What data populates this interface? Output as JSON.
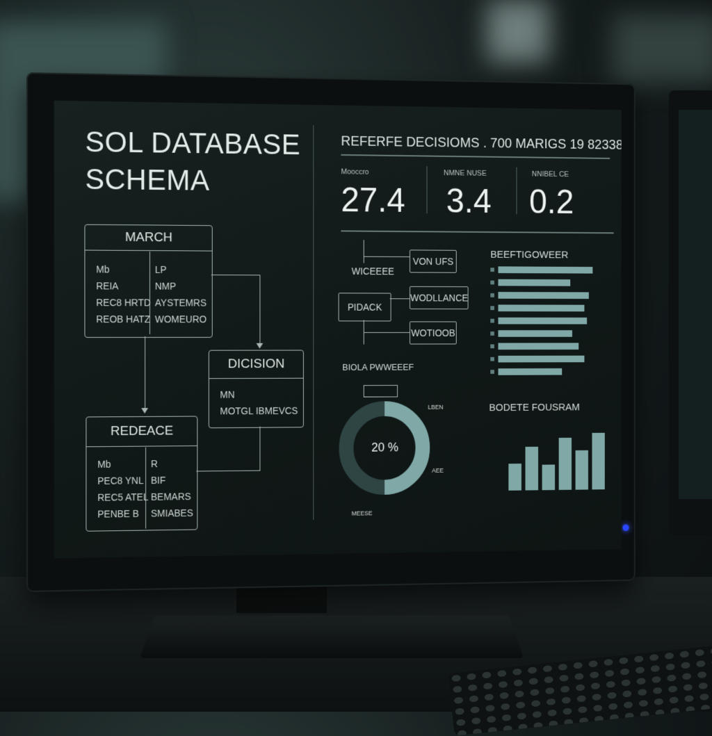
{
  "schema": {
    "title_line1": "SOL DATABASE",
    "title_line2": "SCHEMA",
    "tables": [
      {
        "name": "MARCH",
        "rows": [
          [
            "Mb",
            "LP"
          ],
          [
            "REIA",
            "NMP"
          ],
          [
            "REC8 HRTD",
            "AYSTEMRS"
          ],
          [
            "REOB HATZ",
            "WOMEURO"
          ]
        ]
      },
      {
        "name": "DICISION",
        "rows": [
          [
            "MN",
            ""
          ],
          [
            "MOTGL IBMEVCS",
            ""
          ]
        ]
      },
      {
        "name": "REDEACE",
        "rows": [
          [
            "Mb",
            "R"
          ],
          [
            "PEC8 YNL",
            "BIF"
          ],
          [
            "REC5 ATEL",
            "BEMARS"
          ],
          [
            "PENBE B",
            "SMIABES"
          ]
        ]
      }
    ]
  },
  "dashboard": {
    "header": "REFERFE DECISIOMS . 700 MARIGS 19 82338",
    "metrics": [
      {
        "label": "Mooccro",
        "value": "27.4"
      },
      {
        "label": "NMNE NUSE",
        "value": "3.4"
      },
      {
        "label": "NNIBEL CE",
        "value": "0.2"
      }
    ],
    "flow": {
      "left_label": "WICEEEE",
      "left_box": "PIDACK",
      "right_boxes": [
        "VON UFS",
        "WODLLANCE",
        "WOTIOOB"
      ]
    },
    "donut": {
      "title": "BIOLA PWWEEEF",
      "center_label": "20 %",
      "percent": 20,
      "side_label_1": "LBEN",
      "side_label_2": "AEE",
      "bottom_label": "MEESE"
    },
    "hbar_chart": {
      "title": "BEEFTIGOWEER",
      "values": [
        0.92,
        0.7,
        0.88,
        0.84,
        0.86,
        0.72,
        0.78,
        0.84,
        0.62
      ]
    },
    "vbar_chart": {
      "title": "BODETE FOUSRAM",
      "values": [
        0.42,
        0.68,
        0.4,
        0.82,
        0.62,
        0.9
      ]
    }
  },
  "colors": {
    "accent": "#7fa8a7",
    "power_led": "#2a46ff"
  }
}
